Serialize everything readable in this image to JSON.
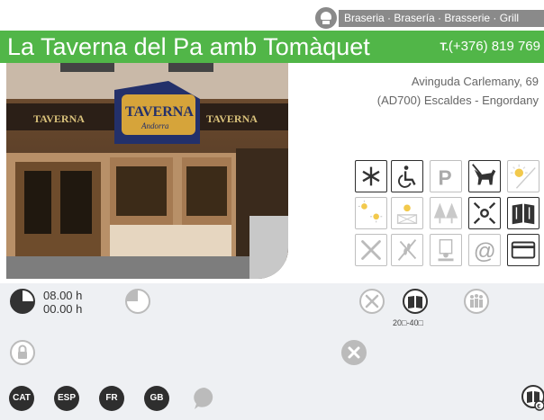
{
  "categories": "Braseria · Brasería · Brasserie · Grill",
  "title": "La Taverna del Pa amb Tomàquet",
  "phone": {
    "prefix": "T.",
    "number": "(+376) 819 769"
  },
  "address": {
    "line1": "Avinguda Carlemany, 69",
    "line2": "(AD700) Escaldes - Engordany"
  },
  "photo": {
    "sign_text": "TAVERNA",
    "sign_sub": "Andorra"
  },
  "amenities": [
    {
      "icon": "snowflake-icon",
      "active": true
    },
    {
      "icon": "wheelchair-icon",
      "active": true
    },
    {
      "icon": "parking-icon",
      "active": false
    },
    {
      "icon": "dog-icon",
      "active": true
    },
    {
      "icon": "sun-icon",
      "active": false
    },
    {
      "icon": "terrace-icon",
      "active": false
    },
    {
      "icon": "window-sun-icon",
      "active": false
    },
    {
      "icon": "trees-icon",
      "active": false
    },
    {
      "icon": "center-location-icon",
      "active": true
    },
    {
      "icon": "menu-book-icon",
      "active": true
    },
    {
      "icon": "cutlery-icon",
      "active": false
    },
    {
      "icon": "gluten-free-icon",
      "active": false
    },
    {
      "icon": "takeaway-icon",
      "active": false
    },
    {
      "icon": "email-icon",
      "active": false
    },
    {
      "icon": "credit-card-icon",
      "active": false
    }
  ],
  "hours": {
    "open": "08.00 h",
    "close": "00.00 h"
  },
  "price_range": "20□-40□",
  "languages": [
    "CAT",
    "ESP",
    "FR",
    "GB"
  ]
}
